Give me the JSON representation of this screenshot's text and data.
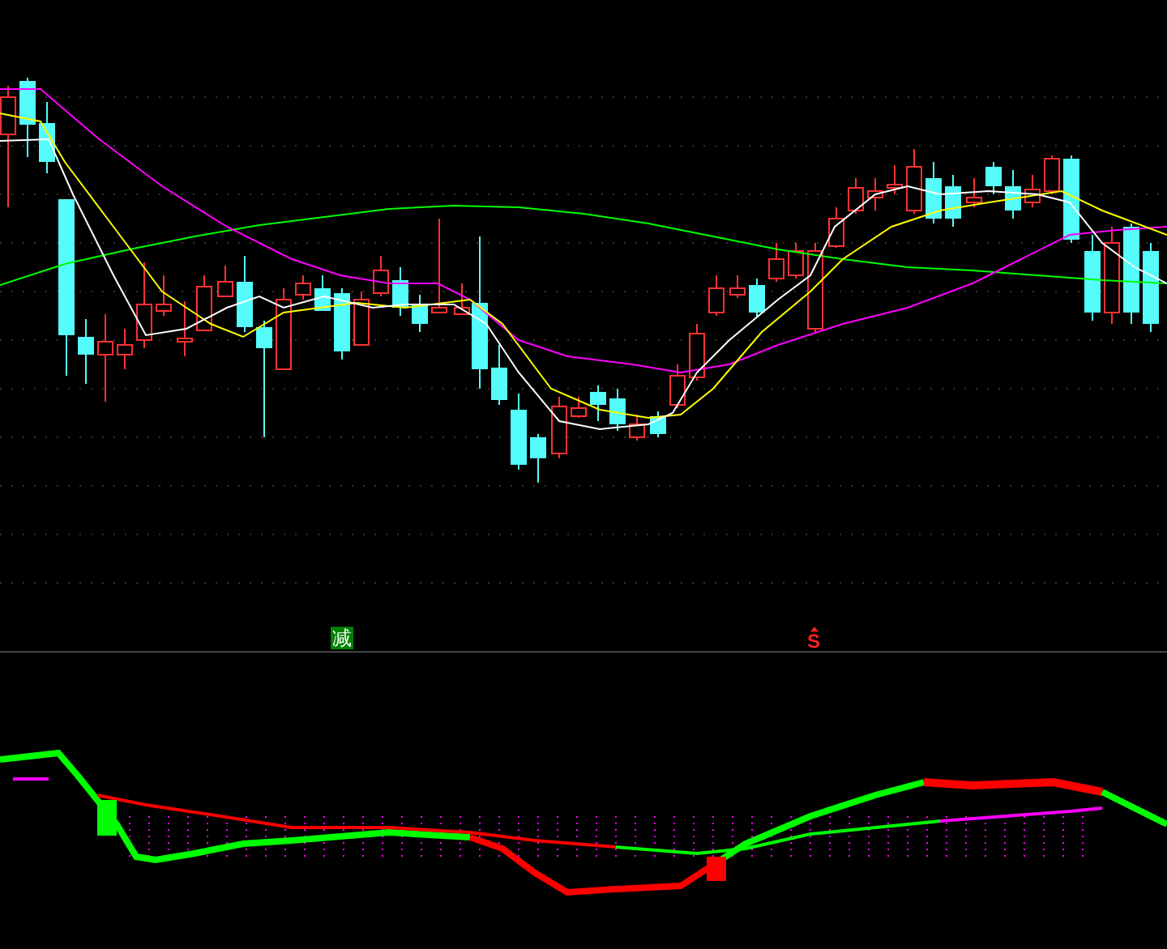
{
  "signals": [
    {
      "kind": "reduce",
      "label": "减"
    },
    {
      "kind": "sell",
      "label": "S"
    }
  ]
}
